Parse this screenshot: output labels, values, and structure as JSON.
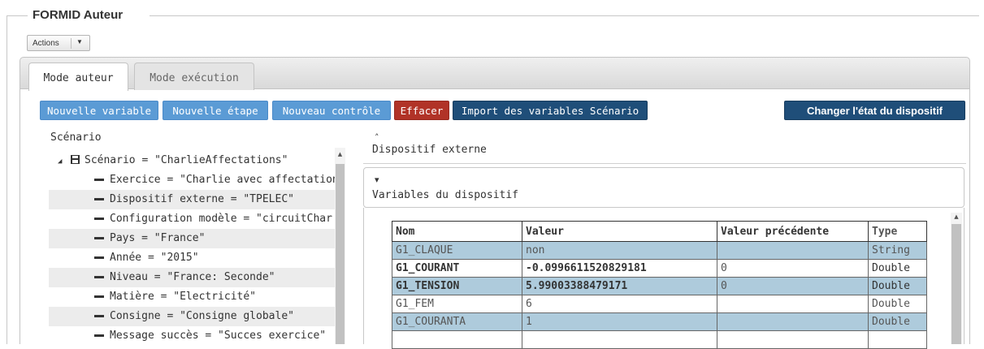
{
  "panel": {
    "title": "FORMID Auteur"
  },
  "actions": {
    "label": "Actions",
    "caret": "▼"
  },
  "tabs": [
    {
      "label": "Mode auteur",
      "active": true
    },
    {
      "label": "Mode exécution",
      "active": false
    }
  ],
  "toolbar": {
    "nouvelle_variable": "Nouvelle variable",
    "nouvelle_etape": "Nouvelle étape",
    "nouveau_controle": "Nouveau contrôle",
    "effacer": "Effacer",
    "import": "Import des variables Scénario",
    "changer_etat": "Changer l'état du dispositif"
  },
  "scenario": {
    "title": "Scénario",
    "root": "Scénario = \"CharlieAffectations\"",
    "items": [
      "Exercice = \"Charlie avec affectation",
      "Dispositif externe = \"TPELEC\"",
      "Configuration modèle = \"circuitChar",
      "Pays = \"France\"",
      "Année = \"2015\"",
      "Niveau = \"France: Seconde\"",
      "Matière = \"Electricité\"",
      "Consigne = \"Consigne globale\"",
      "Message succès = \"Succes exercice\""
    ]
  },
  "accordion": {
    "dispositif_externe": "Dispositif externe",
    "variables_dispositif": "Variables du dispositif",
    "chevron_up": "˄",
    "chevron_down": "▾"
  },
  "variables_table": {
    "headers": [
      "Nom",
      "Valeur",
      "Valeur précédente",
      "Type"
    ],
    "rows": [
      [
        "G1_CLAQUE",
        "non",
        "",
        "String"
      ],
      [
        "G1_COURANT",
        "-0.0996611520829181",
        "0",
        "Double"
      ],
      [
        "G1_TENSION",
        "5.99003388479171",
        "0",
        "Double"
      ],
      [
        "G1_FEM",
        "6",
        "",
        "Double"
      ],
      [
        "G1_COURANTA",
        "1",
        "",
        "Double"
      ]
    ]
  },
  "colors": {
    "button_blue": "#5b9bd5",
    "button_red": "#b13327",
    "button_navy": "#1f4e79",
    "row_highlight": "#aecbdc"
  }
}
